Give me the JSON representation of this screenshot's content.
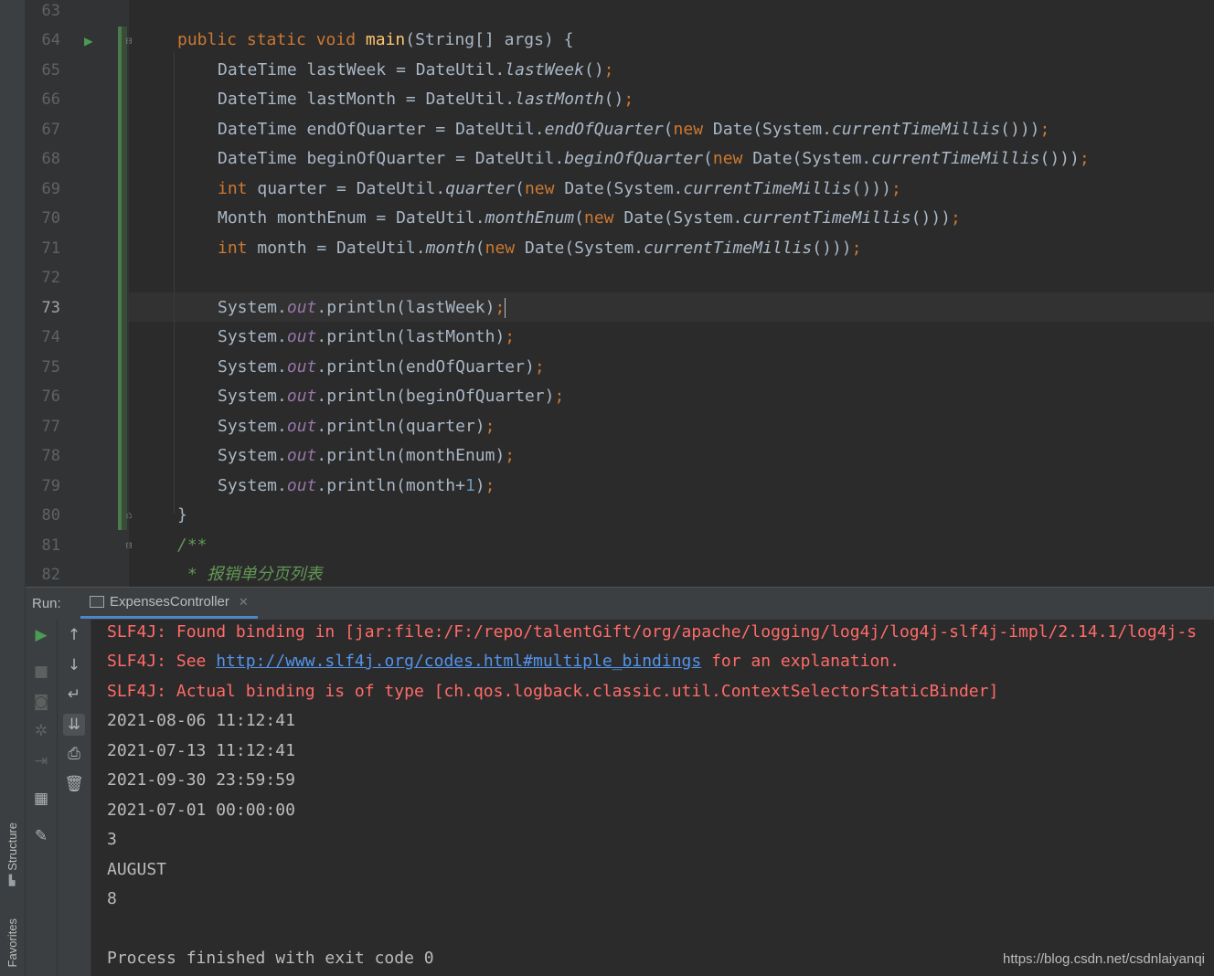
{
  "side_tabs": {
    "structure": "Structure",
    "favorites": "Favorites"
  },
  "editor": {
    "line_numbers": [
      "63",
      "64",
      "65",
      "66",
      "67",
      "68",
      "69",
      "70",
      "71",
      "72",
      "73",
      "74",
      "75",
      "76",
      "77",
      "78",
      "79",
      "80",
      "81",
      "82"
    ],
    "current_line": "73",
    "code": {
      "l64_kw": "public static void ",
      "l64_fn": "main",
      "l64_rest": "(String[] args) {",
      "l65_a": "DateTime lastWeek = DateUtil.",
      "l65_m": "lastWeek",
      "l65_b": "()",
      "l66_a": "DateTime lastMonth = DateUtil.",
      "l66_m": "lastMonth",
      "l66_b": "()",
      "l67_a": "DateTime endOfQuarter = DateUtil.",
      "l67_m": "endOfQuarter",
      "l67_b": "(",
      "l67_c": " Date(System.",
      "l67_d": "currentTimeMillis",
      "l67_e": "()))",
      "l68_a": "DateTime beginOfQuarter = DateUtil.",
      "l68_m": "beginOfQuarter",
      "l68_b": "(",
      "l68_c": " Date(System.",
      "l68_d": "currentTimeMillis",
      "l68_e": "()))",
      "l69_kw": "int",
      "l69_a": " quarter = DateUtil.",
      "l69_m": "quarter",
      "l69_b": "(",
      "l69_c": " Date(System.",
      "l69_d": "currentTimeMillis",
      "l69_e": "()))",
      "l70_a": "Month monthEnum = DateUtil.",
      "l70_m": "monthEnum",
      "l70_b": "(",
      "l70_c": " Date(System.",
      "l70_d": "currentTimeMillis",
      "l70_e": "()))",
      "l71_kw": "int",
      "l71_a": " month = DateUtil.",
      "l71_m": "month",
      "l71_b": "(",
      "l71_c": " Date(System.",
      "l71_d": "currentTimeMillis",
      "l71_e": "()))",
      "kw_new": "new",
      "semi": ";",
      "sys": "System.",
      "out": "out",
      "println": ".println(",
      "l73_arg": "lastWeek)",
      "l74_arg": "lastMonth)",
      "l75_arg": "endOfQuarter)",
      "l76_arg": "beginOfQuarter)",
      "l77_arg": "quarter)",
      "l78_arg": "monthEnum)",
      "l79_arg_a": "month+",
      "l79_arg_num": "1",
      "l79_arg_b": ")",
      "l80": "}",
      "l81": "/**",
      "l82": " * 报销单分页列表"
    }
  },
  "run_panel": {
    "label": "Run:",
    "tab_title": "ExpensesController",
    "console": {
      "err1": "SLF4J: Found binding in [jar:file:/F:/repo/talentGift/org/apache/logging/log4j/log4j-slf4j-impl/2.14.1/log4j-s",
      "err2_a": "SLF4J: See ",
      "err2_link": "http://www.slf4j.org/codes.html#multiple_bindings",
      "err2_b": " for an explanation.",
      "err3": "SLF4J: Actual binding is of type [ch.qos.logback.classic.util.ContextSelectorStaticBinder]",
      "out1": "2021-08-06 11:12:41",
      "out2": "2021-07-13 11:12:41",
      "out3": "2021-09-30 23:59:59",
      "out4": "2021-07-01 00:00:00",
      "out5": "3",
      "out6": "AUGUST",
      "out7": "8",
      "exit": "Process finished with exit code 0"
    }
  },
  "watermark": "https://blog.csdn.net/csdnlaiyanqi"
}
